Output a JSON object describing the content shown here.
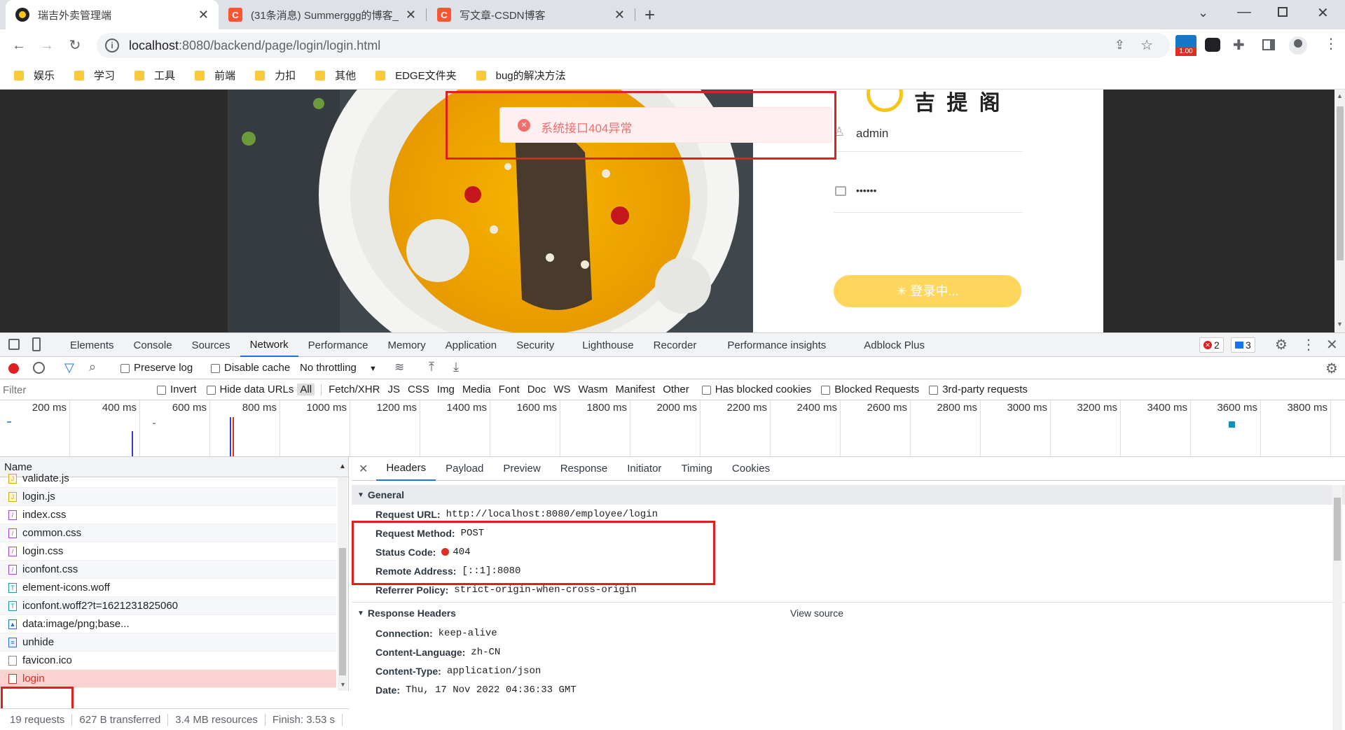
{
  "tabs": [
    {
      "title": "瑞吉外卖管理端",
      "active": true
    },
    {
      "title": "(31条消息) Summerggg的博客_",
      "active": false
    },
    {
      "title": "写文章-CSDN博客",
      "active": false
    }
  ],
  "address": {
    "host": "localhost",
    "path": ":8080/backend/page/login/login.html"
  },
  "extension_badge": "1.00",
  "bookmarks": [
    "娱乐",
    "学习",
    "工具",
    "前端",
    "力扣",
    "其他",
    "EDGE文件夹",
    "bug的解决方法"
  ],
  "page": {
    "logo_text": "吉 提 阁",
    "error_message": "系统接口404异常",
    "username": "admin",
    "password_mask": "••••••",
    "login_button": "登录中..."
  },
  "devtools": {
    "tabs": [
      "Elements",
      "Console",
      "Sources",
      "Network",
      "Performance",
      "Memory",
      "Application",
      "Security",
      "Lighthouse",
      "Recorder",
      "Performance insights",
      "Adblock Plus"
    ],
    "selected_tab": "Network",
    "error_count": "2",
    "message_count": "3",
    "toolbar": {
      "preserve_log": "Preserve log",
      "disable_cache": "Disable cache",
      "throttling": "No throttling"
    },
    "filter_bar": {
      "placeholder": "Filter",
      "invert": "Invert",
      "hide_data_urls": "Hide data URLs",
      "types": [
        "All",
        "Fetch/XHR",
        "JS",
        "CSS",
        "Img",
        "Media",
        "Font",
        "Doc",
        "WS",
        "Wasm",
        "Manifest",
        "Other"
      ],
      "has_blocked_cookies": "Has blocked cookies",
      "blocked_requests": "Blocked Requests",
      "third_party": "3rd-party requests"
    },
    "timeline_ticks": [
      "200 ms",
      "400 ms",
      "600 ms",
      "800 ms",
      "1000 ms",
      "1200 ms",
      "1400 ms",
      "1600 ms",
      "1800 ms",
      "2000 ms",
      "2200 ms",
      "2400 ms",
      "2600 ms",
      "2800 ms",
      "3000 ms",
      "3200 ms",
      "3400 ms",
      "3600 ms",
      "3800 ms"
    ],
    "requests_header": "Name",
    "requests": [
      {
        "name": "validate.js",
        "type": "js"
      },
      {
        "name": "login.js",
        "type": "js"
      },
      {
        "name": "index.css",
        "type": "css"
      },
      {
        "name": "common.css",
        "type": "css"
      },
      {
        "name": "login.css",
        "type": "css"
      },
      {
        "name": "iconfont.css",
        "type": "css"
      },
      {
        "name": "element-icons.woff",
        "type": "font"
      },
      {
        "name": "iconfont.woff2?t=1621231825060",
        "type": "font"
      },
      {
        "name": "data:image/png;base...",
        "type": "img"
      },
      {
        "name": "unhide",
        "type": "doc"
      },
      {
        "name": "favicon.ico",
        "type": "other"
      },
      {
        "name": "login",
        "type": "error"
      }
    ],
    "status_bar": {
      "requests": "19 requests",
      "transferred": "627 B transferred",
      "resources": "3.4 MB resources",
      "finish": "Finish: 3.53 s"
    },
    "detail_tabs": [
      "Headers",
      "Payload",
      "Preview",
      "Response",
      "Initiator",
      "Timing",
      "Cookies"
    ],
    "general": {
      "title": "General",
      "rows": [
        {
          "key": "Request URL:",
          "value": "http://localhost:8080/employee/login"
        },
        {
          "key": "Request Method:",
          "value": "POST"
        },
        {
          "key": "Status Code:",
          "value": "404"
        },
        {
          "key": "Remote Address:",
          "value": "[::1]:8080"
        },
        {
          "key": "Referrer Policy:",
          "value": "strict-origin-when-cross-origin"
        }
      ]
    },
    "response_headers": {
      "title": "Response Headers",
      "view_source": "View source",
      "rows": [
        {
          "key": "Connection:",
          "value": "keep-alive"
        },
        {
          "key": "Content-Language:",
          "value": "zh-CN"
        },
        {
          "key": "Content-Type:",
          "value": "application/json"
        },
        {
          "key": "Date:",
          "value": "Thu, 17 Nov 2022 04:36:33 GMT"
        }
      ]
    }
  },
  "colors": {
    "error_red": "#e02020",
    "login_button": "#ffd65c",
    "chrome_tabstrip": "#dee1e6"
  }
}
